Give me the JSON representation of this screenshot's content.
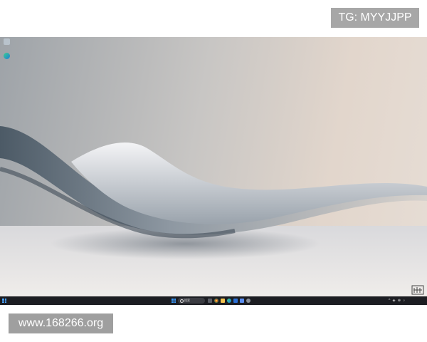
{
  "desktop": {
    "icons": [
      {
        "icon": "recycle-bin-icon",
        "label": ""
      },
      {
        "icon": "edge-browser-icon",
        "label": ""
      }
    ],
    "wallpaper": "abstract-silver-wave"
  },
  "taskbar": {
    "search_placeholder": "搜索",
    "pinned": [
      "windows-start-icon",
      "task-view-icon",
      "chrome-icon",
      "file-explorer-icon",
      "edge-icon",
      "word-icon",
      "store-icon",
      "settings-icon"
    ],
    "tray_icons": "^ ◈ ⊕ ♪",
    "clock_time": "",
    "clock_date": ""
  },
  "watermarks": {
    "telegram": "TG: MYYJJPP",
    "website": "www.168266.org"
  },
  "colors": {
    "taskbar_bg": "#1c1d22",
    "accent_blue": "#3b9bff",
    "watermark_grey": "#a7a7a7"
  }
}
